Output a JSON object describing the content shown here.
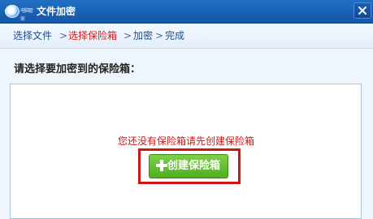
{
  "window": {
    "title": "文件加密",
    "app_logo_text": "电脑管家"
  },
  "breadcrumb": {
    "steps": [
      {
        "label": "选择文件",
        "active": false
      },
      {
        "label": "选择保险箱",
        "active": true
      },
      {
        "label": "加密",
        "active": false
      },
      {
        "label": "完成",
        "active": false
      }
    ],
    "separator": ">"
  },
  "main": {
    "prompt": "请选择要加密到的保险箱：",
    "empty_message": "您还没有保险箱请先创建保险箱",
    "create_button_label": "创建保险箱"
  },
  "colors": {
    "titlebar": "#1f6fc4",
    "active_step": "#d12222",
    "empty_message": "#c41a1a",
    "create_button": "#5cb82a",
    "highlight_frame": "#d01515"
  },
  "icons": [
    "app-logo-icon",
    "close-icon",
    "plus-icon"
  ]
}
